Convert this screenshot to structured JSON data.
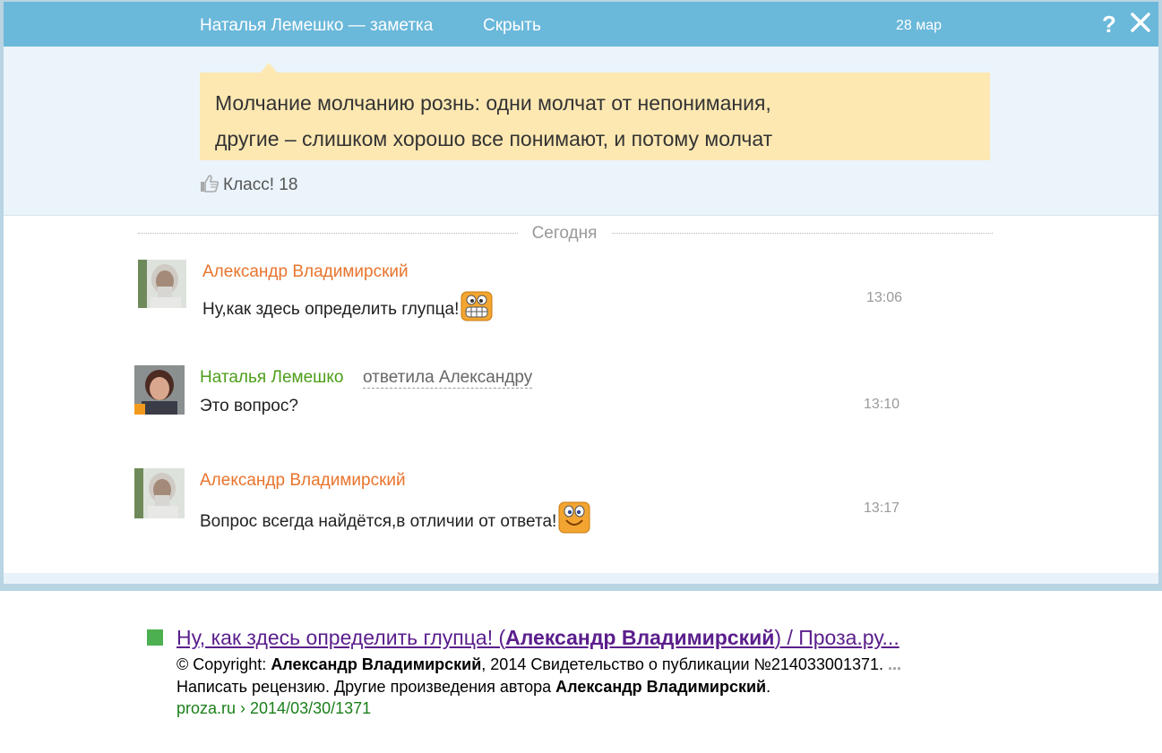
{
  "titlebar": {
    "title": "Наталья Лемешко — заметка",
    "hide_label": "Скрыть",
    "date": "28 мар",
    "help_label": "?"
  },
  "note": {
    "line1": "Молчание молчанию рознь: одни молчат от непонимания,",
    "line2": "другие – слишком хорошо все понимают, и потому молчат",
    "klass_label": "Класс!",
    "klass_count": "18"
  },
  "divider_label": "Сегодня",
  "comments": [
    {
      "author": "Александр Владимирский",
      "text": "Ну,как здесь определить глупца!",
      "time": "13:06"
    },
    {
      "author": "Наталья Лемешко",
      "reply_to": "ответила Александру",
      "text": "Это вопрос?",
      "time": "13:10"
    },
    {
      "author": "Александр Владимирский",
      "text": "Вопрос всегда найдётся,в отличии от ответа!",
      "time": "13:17"
    }
  ],
  "search_result": {
    "title_part1": "Ну, как здесь определить глупца! (",
    "title_bold": "Александр Владимирский",
    "title_part2": ") / Проза.ру...",
    "line1_a": "© Copyright: ",
    "line1_bold": "Александр Владимирский",
    "line1_b": ", 2014 Свидетельство о публикации №214033001371. ",
    "line1_ellipsis": "...",
    "line2_a": "Написать рецензию. Другие произведения автора ",
    "line2_bold": "Александр Владимирский",
    "line2_b": ".",
    "url": "proza.ru › 2014/03/30/1371"
  },
  "colors": {
    "titlebar": "#6ab8da",
    "note_bg": "#fde8b2",
    "author_orange": "#e8742c",
    "author_green": "#4c9e1a",
    "result_link": "#5a1e8c",
    "result_url": "#1a7f1a"
  }
}
